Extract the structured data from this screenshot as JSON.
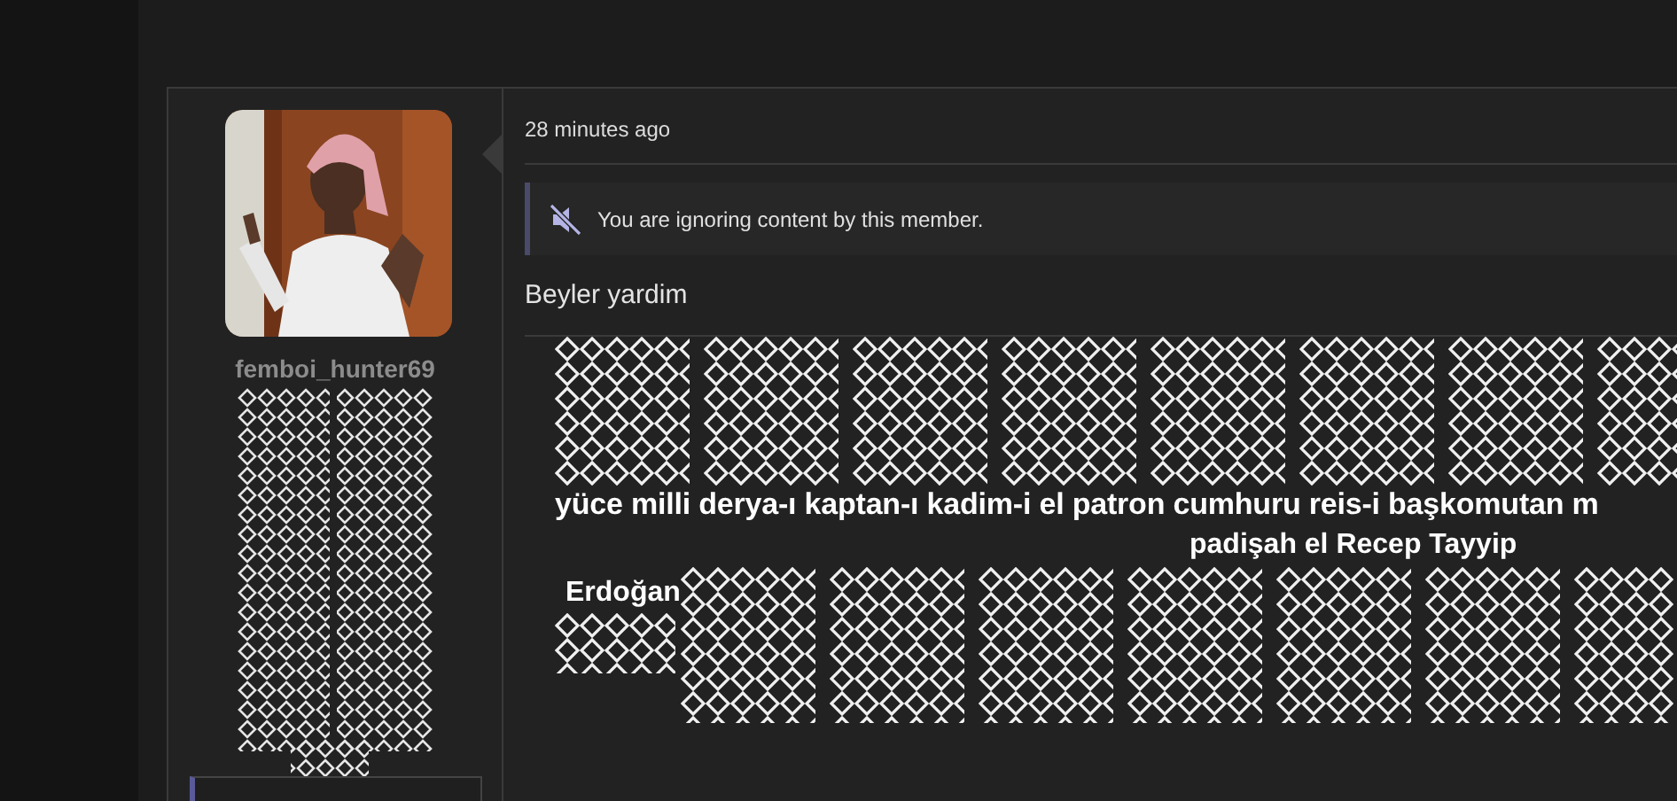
{
  "post": {
    "author": {
      "username": "femboi_hunter69"
    },
    "time": "28 minutes ago",
    "ignored_notice": "You are ignoring content by this member.",
    "title": "Beyler yardim",
    "body": {
      "line_1": "yüce milli derya-ı kaptan-ı kadim-i el patron cumhuru reis-i başkomutan m",
      "line_2": "padişah el Recep Tayyip",
      "line_3": "Erdoğan"
    }
  }
}
